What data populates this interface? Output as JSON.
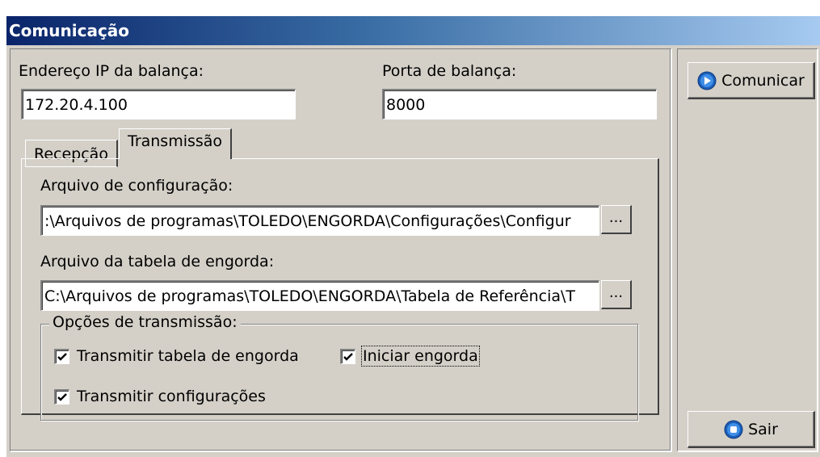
{
  "window": {
    "title": "Comunicação"
  },
  "connection": {
    "ip_label": "Endereço IP da balança:",
    "ip_value": "172.20.4.100",
    "port_label": "Porta de balança:",
    "port_value": "8000"
  },
  "tabs": [
    {
      "label": "Recepção",
      "selected": false
    },
    {
      "label": "Transmissão",
      "selected": true
    }
  ],
  "transmissao": {
    "config_label": "Arquivo de configuração:",
    "config_value": ":\\Arquivos de programas\\TOLEDO\\ENGORDA\\Configurações\\Configur",
    "tabela_label": "Arquivo da tabela de engorda:",
    "tabela_value": "C:\\Arquivos de programas\\TOLEDO\\ENGORDA\\Tabela de Referência\\T",
    "browse_label": "...",
    "options_title": "Opções de transmissão:",
    "options": [
      {
        "label": "Transmitir tabela de engorda",
        "checked": true
      },
      {
        "label": "Iniciar engorda",
        "checked": true
      },
      {
        "label": "Transmitir configurações",
        "checked": true
      }
    ]
  },
  "buttons": {
    "comunicar": "Comunicar",
    "sair": "Sair",
    "icon": "blue-circle-icon"
  },
  "colors": {
    "title_start": "#0a246a",
    "title_end": "#a6caf0",
    "face": "#d4d0c8"
  }
}
